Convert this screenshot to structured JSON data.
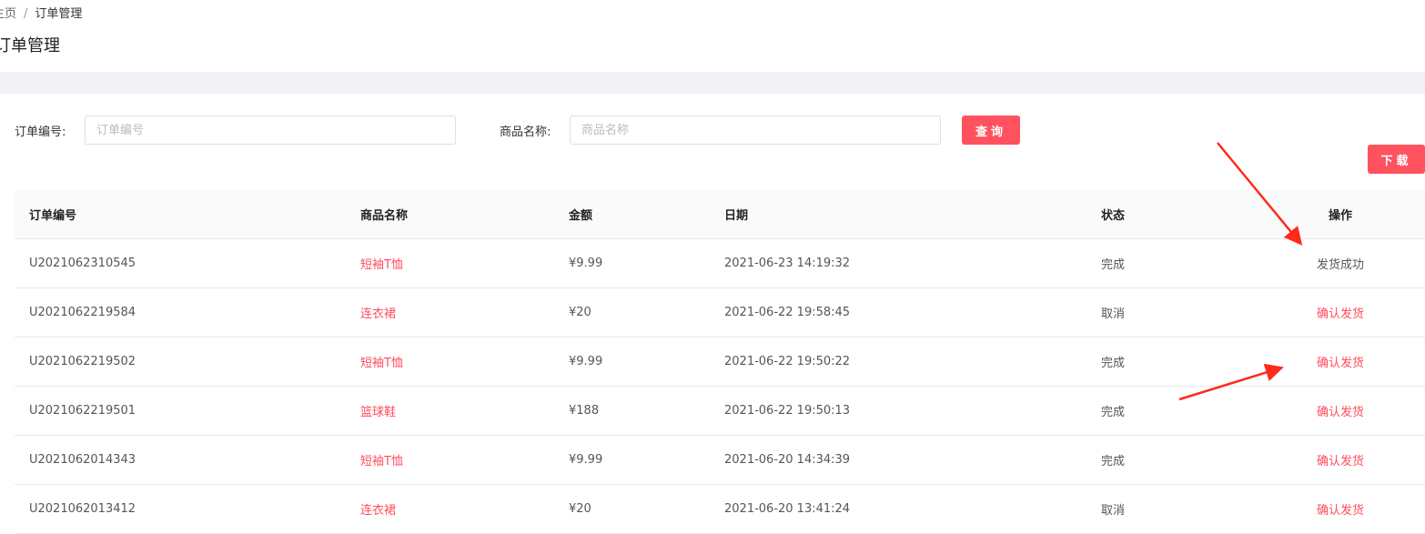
{
  "breadcrumb": {
    "home": "主页",
    "separator": "/",
    "current": "订单管理"
  },
  "page_title": "订单管理",
  "search": {
    "order_label": "订单编号:",
    "order_placeholder": "订单编号",
    "product_label": "商品名称:",
    "product_placeholder": "商品名称",
    "query_button": "查询",
    "download_button": "下载"
  },
  "table": {
    "headers": [
      "订单编号",
      "商品名称",
      "金额",
      "日期",
      "状态",
      "操作"
    ],
    "rows": [
      {
        "id": "U2021062310545",
        "product": "短袖T恤",
        "amount": "¥9.99",
        "date": "2021-06-23 14:19:32",
        "status": "完成",
        "action": "发货成功",
        "action_done": true
      },
      {
        "id": "U2021062219584",
        "product": "连衣裙",
        "amount": "¥20",
        "date": "2021-06-22 19:58:45",
        "status": "取消",
        "action": "确认发货"
      },
      {
        "id": "U2021062219502",
        "product": "短袖T恤",
        "amount": "¥9.99",
        "date": "2021-06-22 19:50:22",
        "status": "完成",
        "action": "确认发货"
      },
      {
        "id": "U2021062219501",
        "product": "篮球鞋",
        "amount": "¥188",
        "date": "2021-06-22 19:50:13",
        "status": "完成",
        "action": "确认发货"
      },
      {
        "id": "U2021062014343",
        "product": "短袖T恤",
        "amount": "¥9.99",
        "date": "2021-06-20 14:34:39",
        "status": "完成",
        "action": "确认发货"
      },
      {
        "id": "U2021062013412",
        "product": "连衣裙",
        "amount": "¥20",
        "date": "2021-06-20 13:41:24",
        "status": "取消",
        "action": "确认发货"
      }
    ]
  },
  "colors": {
    "accent": "#ff525e",
    "annotation": "#ff2a1a"
  }
}
